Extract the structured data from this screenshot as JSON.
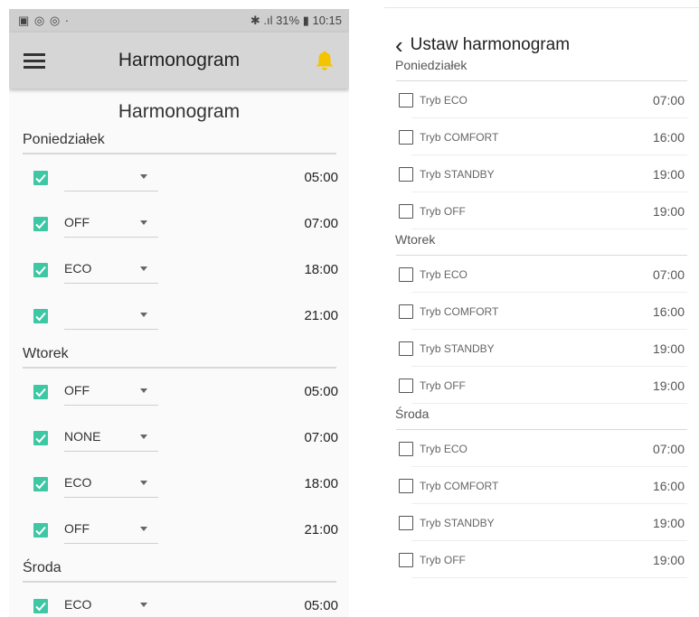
{
  "left": {
    "statusbar": {
      "icons": "▣ ◎ ◎ ·",
      "right": "✱ .ıl 31% ▮ 10:15"
    },
    "appbar_title": "Harmonogram",
    "page_title": "Harmonogram",
    "days": [
      {
        "name": "Poniedziałek",
        "rows": [
          {
            "mode": "",
            "time": "05:00"
          },
          {
            "mode": "OFF",
            "time": "07:00"
          },
          {
            "mode": "ECO",
            "time": "18:00"
          },
          {
            "mode": "",
            "time": "21:00"
          }
        ]
      },
      {
        "name": "Wtorek",
        "rows": [
          {
            "mode": "OFF",
            "time": "05:00"
          },
          {
            "mode": "NONE",
            "time": "07:00"
          },
          {
            "mode": "ECO",
            "time": "18:00"
          },
          {
            "mode": "OFF",
            "time": "21:00"
          }
        ]
      },
      {
        "name": "Środa",
        "rows": [
          {
            "mode": "ECO",
            "time": "05:00"
          }
        ]
      }
    ],
    "colors": {
      "accent": "#3ec7a4",
      "bell": "#f5c400",
      "appbar": "#d6d6d6"
    }
  },
  "right": {
    "back_icon": "‹",
    "title": "Ustaw harmonogram",
    "days": [
      {
        "name": "Poniedziałek",
        "rows": [
          {
            "label": "Tryb ECO",
            "time": "07:00"
          },
          {
            "label": "Tryb COMFORT",
            "time": "16:00"
          },
          {
            "label": "Tryb STANDBY",
            "time": "19:00"
          },
          {
            "label": "Tryb OFF",
            "time": "19:00"
          }
        ]
      },
      {
        "name": "Wtorek",
        "rows": [
          {
            "label": "Tryb ECO",
            "time": "07:00"
          },
          {
            "label": "Tryb COMFORT",
            "time": "16:00"
          },
          {
            "label": "Tryb STANDBY",
            "time": "19:00"
          },
          {
            "label": "Tryb OFF",
            "time": "19:00"
          }
        ]
      },
      {
        "name": "Środa",
        "rows": [
          {
            "label": "Tryb ECO",
            "time": "07:00"
          },
          {
            "label": "Tryb COMFORT",
            "time": "16:00"
          },
          {
            "label": "Tryb STANDBY",
            "time": "19:00"
          },
          {
            "label": "Tryb OFF",
            "time": "19:00"
          }
        ]
      }
    ]
  }
}
